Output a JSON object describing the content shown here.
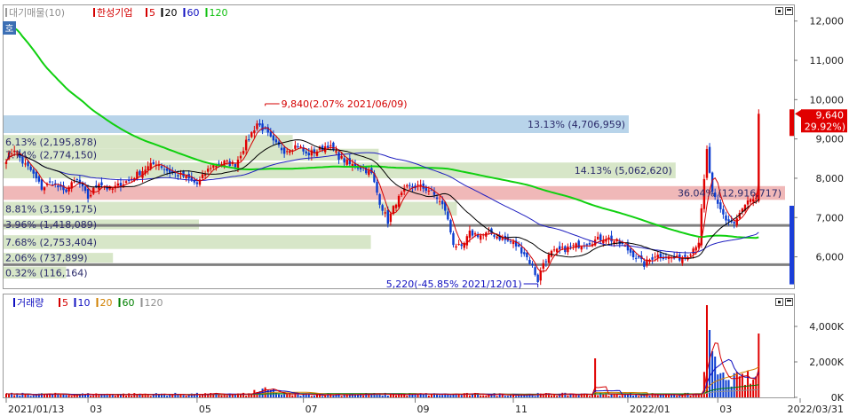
{
  "legend_price": {
    "index_label": "대기매물(10)",
    "stock_name": "한성기업",
    "ma_items": [
      {
        "label": "5",
        "color": "#d40000"
      },
      {
        "label": "20",
        "color": "#000000"
      },
      {
        "label": "60",
        "color": "#1010c0"
      },
      {
        "label": "120",
        "color": "#10c010"
      }
    ]
  },
  "badge": "호",
  "legend_volume": {
    "title": "거래량",
    "ma_items": [
      {
        "label": "5",
        "color": "#d40000"
      },
      {
        "label": "10",
        "color": "#1010c0"
      },
      {
        "label": "20",
        "color": "#d08000"
      },
      {
        "label": "60",
        "color": "#008000"
      },
      {
        "label": "120",
        "color": "#909090"
      }
    ]
  },
  "price_axis_labels": [
    "12,000",
    "11,000",
    "10,000",
    "9,000",
    "8,000",
    "7,000",
    "6,000"
  ],
  "volume_axis_labels": [
    "4,000K",
    "2,000K",
    "0K"
  ],
  "current_price": "9,640",
  "current_change": "( 29.92%)",
  "annotations": {
    "high": "9,840(2.07% 2021/06/09)",
    "low": "5,220(-45.85% 2021/12/01)"
  },
  "supply_zones": [
    {
      "label": "13.13% (4,706,959)",
      "price_low": 9150,
      "price_high": 9600,
      "share": 0.8,
      "color": "#b8d4ea",
      "align": "right"
    },
    {
      "label": "6.13% (2,195,878)",
      "price_low": 8750,
      "price_high": 9100,
      "share": 0.37
    },
    {
      "label": "7.74% (2,774,150)",
      "price_low": 8450,
      "price_high": 8750,
      "share": 0.48
    },
    {
      "label": "14.13% (5,062,620)",
      "price_low": 8000,
      "price_high": 8400,
      "share": 0.86,
      "align": "right"
    },
    {
      "label": "36.04% (12,916,717)",
      "price_low": 7450,
      "price_high": 7800,
      "share": 1.0,
      "color": "#f0b8b8",
      "align": "right"
    },
    {
      "label": "8.81% (3,159,175)",
      "price_low": 7050,
      "price_high": 7400,
      "share": 0.58
    },
    {
      "label": "3.96% (1,418,089)",
      "price_low": 6700,
      "price_high": 6950,
      "share": 0.25
    },
    {
      "label": "7.68% (2,753,404)",
      "price_low": 6200,
      "price_high": 6550,
      "share": 0.47
    },
    {
      "label": "2.06% (737,899)",
      "price_low": 5850,
      "price_high": 6100,
      "share": 0.14
    },
    {
      "label": "0.32% (116,164)",
      "price_low": 5450,
      "price_high": 5750,
      "share": 0.08
    }
  ],
  "x_axis_labels": [
    {
      "label": "2021/01/13",
      "idx": 0
    },
    {
      "label": "03",
      "idx": 30
    },
    {
      "label": "05",
      "idx": 70
    },
    {
      "label": "07",
      "idx": 109
    },
    {
      "label": "09",
      "idx": 150
    },
    {
      "label": "11",
      "idx": 186
    },
    {
      "label": "2022/01",
      "idx": 228
    },
    {
      "label": "03",
      "idx": 261
    },
    {
      "label": "2022/03/31",
      "idx": 280
    }
  ],
  "chart_data": {
    "type": "candlestick",
    "title": "한성기업",
    "date_range": [
      "2021/01/13",
      "2022/03/31"
    ],
    "ylim": [
      5200,
      12400
    ],
    "volume_ylim": [
      0,
      5400
    ],
    "volume_unit": "K",
    "horizontal_lines": [
      6800,
      5800
    ],
    "close_anchors": [
      [
        0,
        8500
      ],
      [
        3,
        8750
      ],
      [
        6,
        8400
      ],
      [
        9,
        8200
      ],
      [
        13,
        7750
      ],
      [
        17,
        7900
      ],
      [
        21,
        7650
      ],
      [
        26,
        7950
      ],
      [
        30,
        7500
      ],
      [
        34,
        7900
      ],
      [
        38,
        7700
      ],
      [
        45,
        7950
      ],
      [
        50,
        8200
      ],
      [
        55,
        8400
      ],
      [
        60,
        8150
      ],
      [
        65,
        8050
      ],
      [
        70,
        7850
      ],
      [
        75,
        8300
      ],
      [
        80,
        8400
      ],
      [
        84,
        8350
      ],
      [
        88,
        8900
      ],
      [
        92,
        9400
      ],
      [
        95,
        9200
      ],
      [
        98,
        8900
      ],
      [
        102,
        8700
      ],
      [
        107,
        8850
      ],
      [
        110,
        8600
      ],
      [
        114,
        8700
      ],
      [
        118,
        8850
      ],
      [
        122,
        8550
      ],
      [
        126,
        8350
      ],
      [
        131,
        8250
      ],
      [
        134,
        8100
      ],
      [
        137,
        7400
      ],
      [
        140,
        6900
      ],
      [
        143,
        7400
      ],
      [
        147,
        7750
      ],
      [
        151,
        7800
      ],
      [
        155,
        7700
      ],
      [
        158,
        7500
      ],
      [
        161,
        7200
      ],
      [
        164,
        6350
      ],
      [
        167,
        6200
      ],
      [
        170,
        6600
      ],
      [
        174,
        6550
      ],
      [
        178,
        6600
      ],
      [
        182,
        6450
      ],
      [
        186,
        6350
      ],
      [
        190,
        6100
      ],
      [
        193,
        5750
      ],
      [
        195,
        5400
      ],
      [
        197,
        5850
      ],
      [
        200,
        6100
      ],
      [
        205,
        6200
      ],
      [
        210,
        6300
      ],
      [
        215,
        6400
      ],
      [
        220,
        6500
      ],
      [
        226,
        6300
      ],
      [
        231,
        6000
      ],
      [
        234,
        5800
      ],
      [
        238,
        6050
      ],
      [
        242,
        6000
      ],
      [
        246,
        5950
      ],
      [
        250,
        6050
      ],
      [
        254,
        6400
      ],
      [
        257,
        8700
      ],
      [
        259,
        7600
      ],
      [
        261,
        7300
      ],
      [
        264,
        6950
      ],
      [
        267,
        6850
      ],
      [
        270,
        7200
      ],
      [
        272,
        7400
      ],
      [
        275,
        7420
      ],
      [
        276,
        9640
      ]
    ],
    "spike_volumes": [
      [
        216,
        2200
      ],
      [
        257,
        5200
      ],
      [
        258,
        3800
      ],
      [
        259,
        2600
      ],
      [
        260,
        2300
      ],
      [
        276,
        3600
      ]
    ],
    "base_volume_k": 200,
    "current_price": 9640,
    "current_change_pct": 29.92,
    "high": {
      "price": 9840,
      "date": "2021/06/09",
      "pct": 2.07
    },
    "low": {
      "price": 5220,
      "date": "2021/12/01",
      "pct": -45.85
    }
  }
}
